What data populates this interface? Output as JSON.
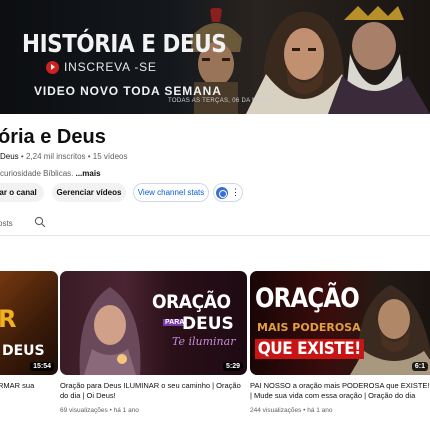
{
  "banner": {
    "title": "HISTÓRIA E DEUS",
    "subscribe": "INSCREVA -SE",
    "weekly": "VIDEO NOVO TODA SEMANA",
    "schedule": "TODAS AS TERÇAS, 06 DA MANHÃ."
  },
  "channel": {
    "name": "ória e Deus",
    "handle": "Deus",
    "subscribers": "2,24 mil inscritos",
    "videos": "15 vídeos",
    "description": "curiosidade Bíblicas.",
    "more": "...mais"
  },
  "buttons": {
    "customize": "izar o canal",
    "manage": "Gerenciar vídeos",
    "stats": "View channel stats"
  },
  "tabs": {
    "posts": "osts"
  },
  "videos": [
    {
      "thumb_text": "DEUS",
      "duration": "15:54",
      "title": "RMAR sua"
    },
    {
      "thumb_text_1": "ORAÇÃO",
      "thumb_text_2": "PARA",
      "thumb_text_3": "DEUS",
      "thumb_text_4": "Te iluminar",
      "duration": "5:29",
      "title": "Oração para Deus ILUMINAR o seu caminho | Oração do dia | Oi Deus!",
      "views": "69 visualizações",
      "age": "há 1 ano"
    },
    {
      "thumb_text_1": "ORAÇÃO",
      "thumb_text_2": "MAIS PODEROSA",
      "thumb_text_3": "QUE EXISTE!",
      "duration": "6:1",
      "title": "PAI NOSSO a oração mais PODEROSA que EXISTE! | Mude sua vida com essa oração | Oração do dia",
      "views": "244 visualizações",
      "age": "há 1 ano"
    }
  ]
}
